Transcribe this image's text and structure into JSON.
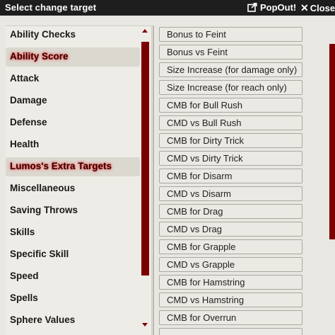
{
  "dialog": {
    "title": "Select change target",
    "popout_label": "PopOut!",
    "close_label": "Close",
    "close_glyph": "✕"
  },
  "categories": [
    {
      "label": "Ability Checks",
      "active": false
    },
    {
      "label": "Ability Score",
      "active": true
    },
    {
      "label": "Attack",
      "active": false
    },
    {
      "label": "Damage",
      "active": false
    },
    {
      "label": "Defense",
      "active": false
    },
    {
      "label": "Health",
      "active": false
    },
    {
      "label": "Lumos's Extra Targets",
      "active": true
    },
    {
      "label": "Miscellaneous",
      "active": false
    },
    {
      "label": "Saving Throws",
      "active": false
    },
    {
      "label": "Skills",
      "active": false
    },
    {
      "label": "Specific Skill",
      "active": false
    },
    {
      "label": "Speed",
      "active": false
    },
    {
      "label": "Spells",
      "active": false
    },
    {
      "label": "Sphere Values",
      "active": false
    }
  ],
  "targets": [
    "Bonus to Feint",
    "Bonus vs Feint",
    "Size Increase (for damage only)",
    "Size Increase (for reach only)",
    "CMB for Bull Rush",
    "CMD vs Bull Rush",
    "CMB for Dirty Trick",
    "CMD vs Dirty Trick",
    "CMB for Disarm",
    "CMD vs Disarm",
    "CMB for Drag",
    "CMD vs Drag",
    "CMB for Grapple",
    "CMD vs Grapple",
    "CMB for Hamstring",
    "CMD vs Hamstring",
    "CMB for Overrun"
  ],
  "colors": {
    "header_bg": "#1e1e1e",
    "scrollbar": "#7a0000",
    "highlight_glow": "#ff4040"
  }
}
